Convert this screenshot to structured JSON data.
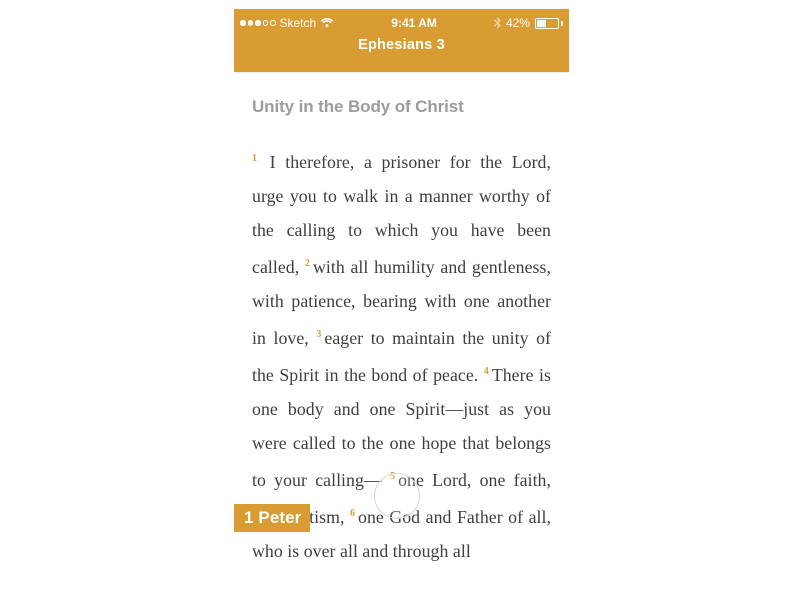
{
  "status_bar": {
    "signal_filled": 3,
    "signal_total": 5,
    "carrier": "Sketch",
    "time": "9:41 AM",
    "battery_percent_text": "42%",
    "battery_fill_pct": 42
  },
  "nav": {
    "title": "Ephesians 3"
  },
  "section_title": "Unity in the Body of Christ",
  "verses": [
    {
      "n": "1",
      "text": "I therefore, a prisoner for the Lord, urge you to walk in a manner worthy of the calling to which you have been called, "
    },
    {
      "n": "2",
      "text": "with all humility and gentleness, with patience, bearing with one another in love, "
    },
    {
      "n": "3",
      "text": "eager to maintain the unity of the Spirit in the bond of peace. "
    },
    {
      "n": "4",
      "text": "There is one body and one Spirit—just as you were called to the one hope that belongs to your calling— "
    },
    {
      "n": "5",
      "text": "one Lord, one faith, one baptism, "
    },
    {
      "n": "6",
      "text": "one God and Father of all, who is over all and through all"
    }
  ],
  "quicknav_label": "1 Peter",
  "colors": {
    "accent": "#d89c33"
  }
}
